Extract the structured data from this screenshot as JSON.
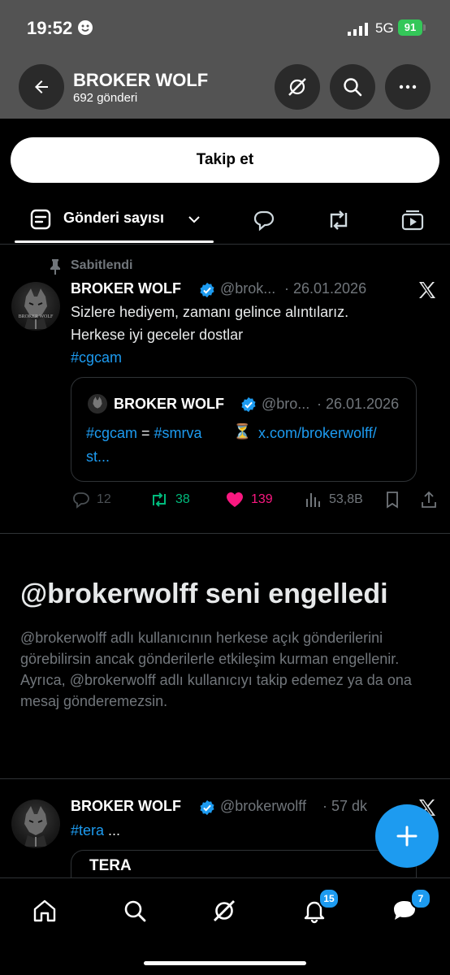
{
  "status_bar": {
    "time": "19:52",
    "network": "5G",
    "battery": "91"
  },
  "header": {
    "title": "BROKER WOLF",
    "subtitle": "692 gönderi"
  },
  "follow_button": "Takip et",
  "tabs": {
    "main_label": "Gönderi sayısı"
  },
  "pinned_post": {
    "pinned_label": "Sabitlendi",
    "author": "BROKER WOLF",
    "handle": "@brok...",
    "date": "· 26.01.2026",
    "avatar_text": "BROKER WOLF",
    "line1": "Sizlere hediyem, zamanı gelince alıntılarız.",
    "line2": "Herkese iyi geceler dostlar",
    "hashtag": "#cgcam",
    "quote": {
      "author": "BROKER WOLF",
      "handle": "@bro...",
      "date": "· 26.01.2026",
      "tag1": "#cgcam",
      "equals": " = ",
      "tag2": "#smrva",
      "hourglass": "⏳",
      "link1": "x.com/brokerwolff/",
      "link2": "st..."
    },
    "stats": {
      "replies": "12",
      "reposts": "38",
      "likes": "139",
      "views": "53,8B"
    }
  },
  "blocked": {
    "title": "@brokerwolff seni engelledi",
    "description": "@brokerwolff adlı kullanıcının herkese açık gönderilerini görebilirsin ancak gönderilerle etkileşim kurman engellenir. Ayrıca, @brokerwolff adlı kullanıcıyı takip edemez ya da ona mesaj gönderemezsin."
  },
  "second_post": {
    "author": "BROKER WOLF",
    "handle": "@brokerwolff",
    "time": "· 57 dk",
    "hashtag": "#tera",
    "ellipsis": " ...",
    "quote_title": "TERA"
  },
  "nav": {
    "notifications_badge": "15",
    "messages_badge": "7"
  },
  "colors": {
    "accent": "#1d9bf0",
    "repost": "#00ba7c",
    "like": "#f91880",
    "header_bg": "#535353"
  }
}
